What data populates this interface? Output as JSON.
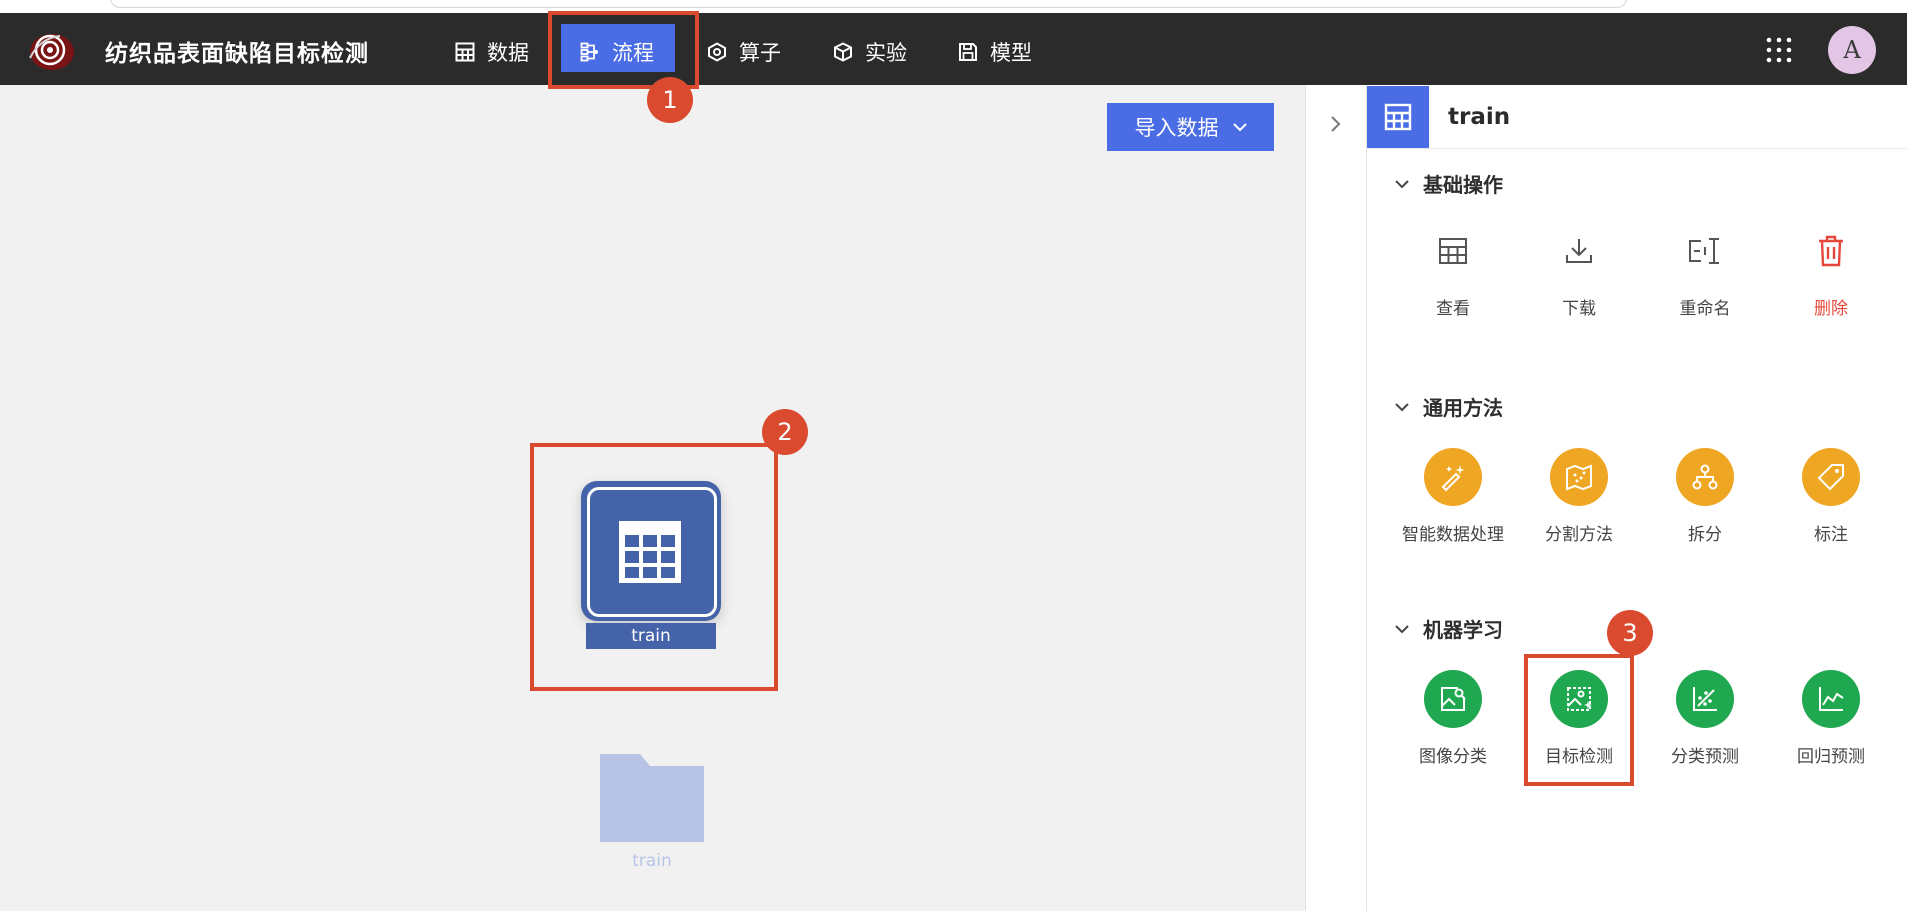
{
  "app": {
    "title": "纺织品表面缺陷目标检测"
  },
  "nav": {
    "items": [
      {
        "label": "数据",
        "icon": "table-icon"
      },
      {
        "label": "流程",
        "icon": "flow-icon",
        "active": true
      },
      {
        "label": "算子",
        "icon": "operator-icon"
      },
      {
        "label": "实验",
        "icon": "cube-icon"
      },
      {
        "label": "模型",
        "icon": "save-icon"
      }
    ]
  },
  "user": {
    "avatar_initial": "A"
  },
  "canvas": {
    "import_button": "导入数据",
    "node": {
      "label": "train",
      "icon": "table-icon"
    },
    "folder": {
      "label": "train",
      "icon": "folder-icon"
    }
  },
  "panel": {
    "title": "train",
    "sections": [
      {
        "title": "基础操作",
        "actions": [
          {
            "label": "查看",
            "icon": "table-icon"
          },
          {
            "label": "下载",
            "icon": "download-icon"
          },
          {
            "label": "重命名",
            "icon": "rename-icon"
          },
          {
            "label": "删除",
            "icon": "trash-icon",
            "color": "#e5483a"
          }
        ]
      },
      {
        "title": "通用方法",
        "actions": [
          {
            "label": "智能数据处理",
            "icon": "magic-wand-icon",
            "color": "#efa623"
          },
          {
            "label": "分割方法",
            "icon": "split-map-icon",
            "color": "#efa623"
          },
          {
            "label": "拆分",
            "icon": "branch-icon",
            "color": "#efa623"
          },
          {
            "label": "标注",
            "icon": "tag-icon",
            "color": "#efa623"
          }
        ]
      },
      {
        "title": "机器学习",
        "actions": [
          {
            "label": "图像分类",
            "icon": "image-classify-icon",
            "color": "#1fa84f"
          },
          {
            "label": "目标检测",
            "icon": "object-detect-icon",
            "color": "#1fa84f"
          },
          {
            "label": "分类预测",
            "icon": "scatter-icon",
            "color": "#1fa84f"
          },
          {
            "label": "回归预测",
            "icon": "line-chart-icon",
            "color": "#1fa84f"
          }
        ]
      }
    ]
  },
  "annotations": [
    "1",
    "2",
    "3"
  ],
  "colors": {
    "accent": "#4a6de5",
    "header": "#2b2b2b",
    "annotation": "#d94a2f",
    "orange": "#efa623",
    "green": "#1fa84f",
    "node": "#4563a8"
  }
}
